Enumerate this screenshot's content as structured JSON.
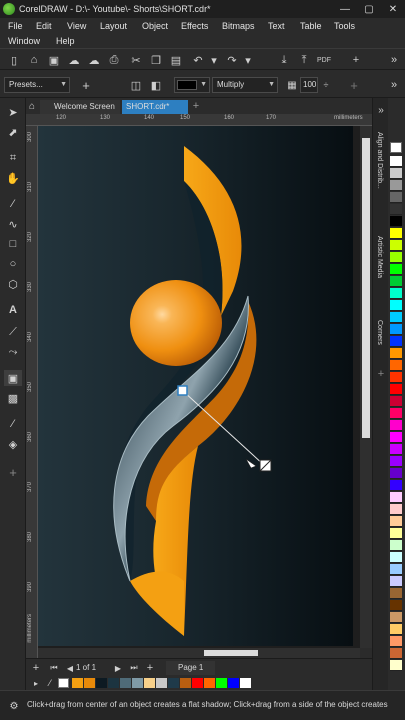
{
  "window": {
    "title": "CorelDRAW - D:\\- Youtube\\- Shorts\\SHORT.cdr*",
    "min": "—",
    "max": "▢",
    "close": "✕"
  },
  "menu": {
    "file": "File",
    "edit": "Edit",
    "view": "View",
    "layout": "Layout",
    "object": "Object",
    "effects": "Effects",
    "bitmaps": "Bitmaps",
    "text": "Text",
    "table": "Table",
    "tools": "Tools",
    "window": "Window",
    "help": "Help"
  },
  "propbar": {
    "presets": "Presets...",
    "merge_mode": "Multiply",
    "opacity": "100",
    "shadow_color": "#000000"
  },
  "tabs": {
    "welcome": "Welcome Screen",
    "document": "SHORT.cdr*"
  },
  "ruler": {
    "h_ticks": [
      "120",
      "130",
      "140",
      "150",
      "160",
      "170"
    ],
    "units": "millimeters",
    "v_ticks": [
      "300",
      "310",
      "320",
      "330",
      "340",
      "350",
      "360",
      "370",
      "380",
      "390"
    ],
    "v_units": "millimeters"
  },
  "pagenav": {
    "of": "1 of 1",
    "page": "Page 1"
  },
  "dockers": {
    "align": "Align and Distrib...",
    "artistic": "Artistic Media",
    "corners": "Corners"
  },
  "palette": {
    "colors": [
      "#ffffff",
      "#cccccc",
      "#999999",
      "#666666",
      "#333333",
      "#000000",
      "#ffff00",
      "#ccff00",
      "#99ff00",
      "#00ff00",
      "#00cc33",
      "#00ffcc",
      "#00ffff",
      "#00ccff",
      "#0099ff",
      "#0033ff",
      "#ff9900",
      "#ff6600",
      "#ff3300",
      "#ff0000",
      "#cc0033",
      "#ff0066",
      "#ff00cc",
      "#ff00ff",
      "#cc00ff",
      "#9900ff",
      "#6600cc",
      "#3300ff",
      "#ffccff",
      "#ffcccc",
      "#ffcc99",
      "#ffff99",
      "#ccffcc",
      "#ccffff",
      "#99ccff",
      "#ccccff",
      "#996633",
      "#663300",
      "#cc9966",
      "#ffcc66",
      "#ff9966",
      "#cc6633",
      "#ffffcc"
    ]
  },
  "document_colors": [
    "#f4a012",
    "#e88a0a",
    "#0d1a22",
    "#1c3440",
    "#4f6b78",
    "#7f9aa6",
    "#f7d08a",
    "#c8c8c8",
    "#1f3a4a",
    "#b85e10",
    "#ff0000",
    "#ff6600",
    "#00ff00",
    "#0000ff",
    "#ffffff"
  ],
  "status": {
    "message": "Click+drag from center of an object creates a flat shadow; Click+drag from a side of the object creates"
  },
  "artwork": {
    "bg_colors": [
      "#1a2a33",
      "#0a141a"
    ],
    "orange": "#f4a012",
    "teal": "#14303d"
  }
}
